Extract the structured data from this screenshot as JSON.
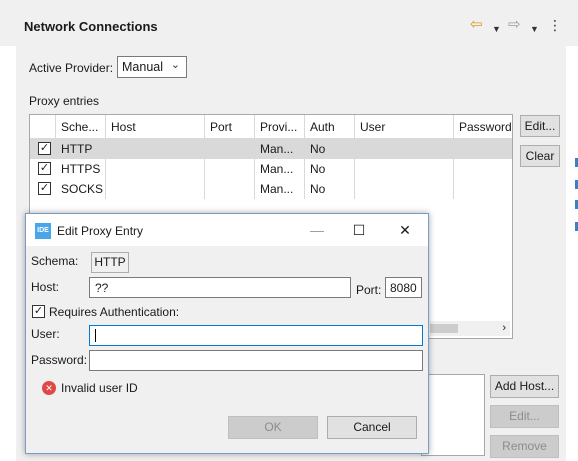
{
  "view": {
    "title": "Network Connections",
    "nav_icons": {
      "back": "back-arrow-icon",
      "back_menu": "dropdown-arrow-icon",
      "forward": "forward-arrow-icon",
      "forward_menu": "dropdown-arrow-icon",
      "more": "vertical-dots-icon"
    }
  },
  "provider": {
    "label": "Active Provider:",
    "selected": "Manual"
  },
  "proxy_entries": {
    "label": "Proxy entries",
    "columns": [
      "Sche...",
      "Host",
      "Port",
      "Provi...",
      "Auth",
      "User",
      "Password"
    ],
    "rows": [
      {
        "schema": "HTTP",
        "host": "",
        "port": "",
        "provider": "Man...",
        "auth": "No",
        "user": "",
        "password": "",
        "checked": true
      },
      {
        "schema": "HTTPS",
        "host": "",
        "port": "",
        "provider": "Man...",
        "auth": "No",
        "user": "",
        "password": "",
        "checked": true
      },
      {
        "schema": "SOCKS",
        "host": "",
        "port": "",
        "provider": "Man...",
        "auth": "No",
        "user": "",
        "password": "",
        "checked": true
      }
    ],
    "buttons": {
      "edit": "Edit...",
      "clear": "Clear"
    }
  },
  "bypass": {
    "buttons": {
      "add_host": "Add Host...",
      "edit": "Edit...",
      "remove": "Remove"
    }
  },
  "dialog": {
    "title": "Edit Proxy Entry",
    "logo_text": "IDE",
    "controls": {
      "minimize": "—",
      "maximize": "☐",
      "close": "✕"
    },
    "schema_label": "Schema:",
    "schema_value": "HTTP",
    "host_label": "Host:",
    "host_value": "??",
    "port_label": "Port:",
    "port_value": "8080",
    "requires_auth_label": "Requires Authentication:",
    "requires_auth_checked": true,
    "user_label": "User:",
    "user_value": "",
    "password_label": "Password:",
    "password_value": "",
    "error_message": "Invalid user ID",
    "ok_label": "OK",
    "cancel_label": "Cancel"
  },
  "colors": {
    "error": "#e04848",
    "focus_border": "#0078d7",
    "link_blue": "#3b7fc4"
  }
}
